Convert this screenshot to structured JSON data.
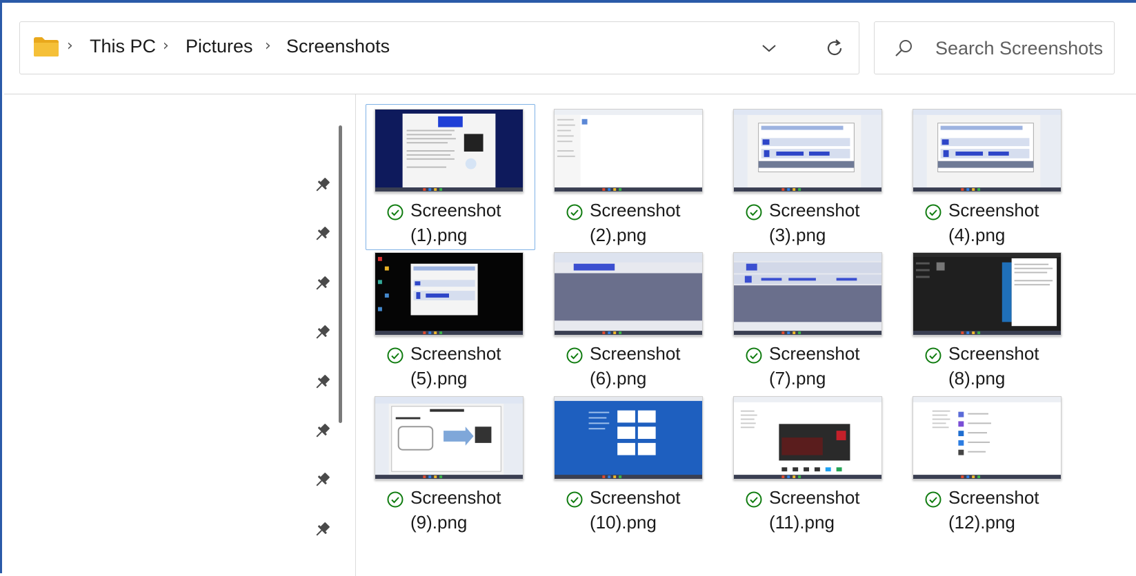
{
  "breadcrumb": {
    "items": [
      "This PC",
      "Pictures",
      "Screenshots"
    ],
    "separator": "›"
  },
  "search": {
    "placeholder": "Search Screenshots"
  },
  "files": [
    {
      "name_line1": "Screenshot",
      "name_line2": "(1).png",
      "selected": true
    },
    {
      "name_line1": "Screenshot",
      "name_line2": "(2).png"
    },
    {
      "name_line1": "Screenshot",
      "name_line2": "(3).png"
    },
    {
      "name_line1": "Screenshot",
      "name_line2": "(4).png"
    },
    {
      "name_line1": "Screenshot",
      "name_line2": "(5).png"
    },
    {
      "name_line1": "Screenshot",
      "name_line2": "(6).png"
    },
    {
      "name_line1": "Screenshot",
      "name_line2": "(7).png"
    },
    {
      "name_line1": "Screenshot",
      "name_line2": "(8).png"
    },
    {
      "name_line1": "Screenshot",
      "name_line2": "(9).png"
    },
    {
      "name_line1": "Screenshot",
      "name_line2": "(10).png"
    },
    {
      "name_line1": "Screenshot",
      "name_line2": "(11).png"
    },
    {
      "name_line1": "Screenshot",
      "name_line2": "(12).png"
    }
  ],
  "colors": {
    "window_border": "#2b5aa8",
    "folder": "#f5c038",
    "sync_ok": "#107c10",
    "selection": "#7fb2e6"
  },
  "icons": {
    "folder": "folder-icon",
    "dropdown": "chevron-down-icon",
    "refresh": "refresh-icon",
    "search": "search-icon",
    "pin": "pin-icon",
    "status": "check-circle-icon"
  }
}
